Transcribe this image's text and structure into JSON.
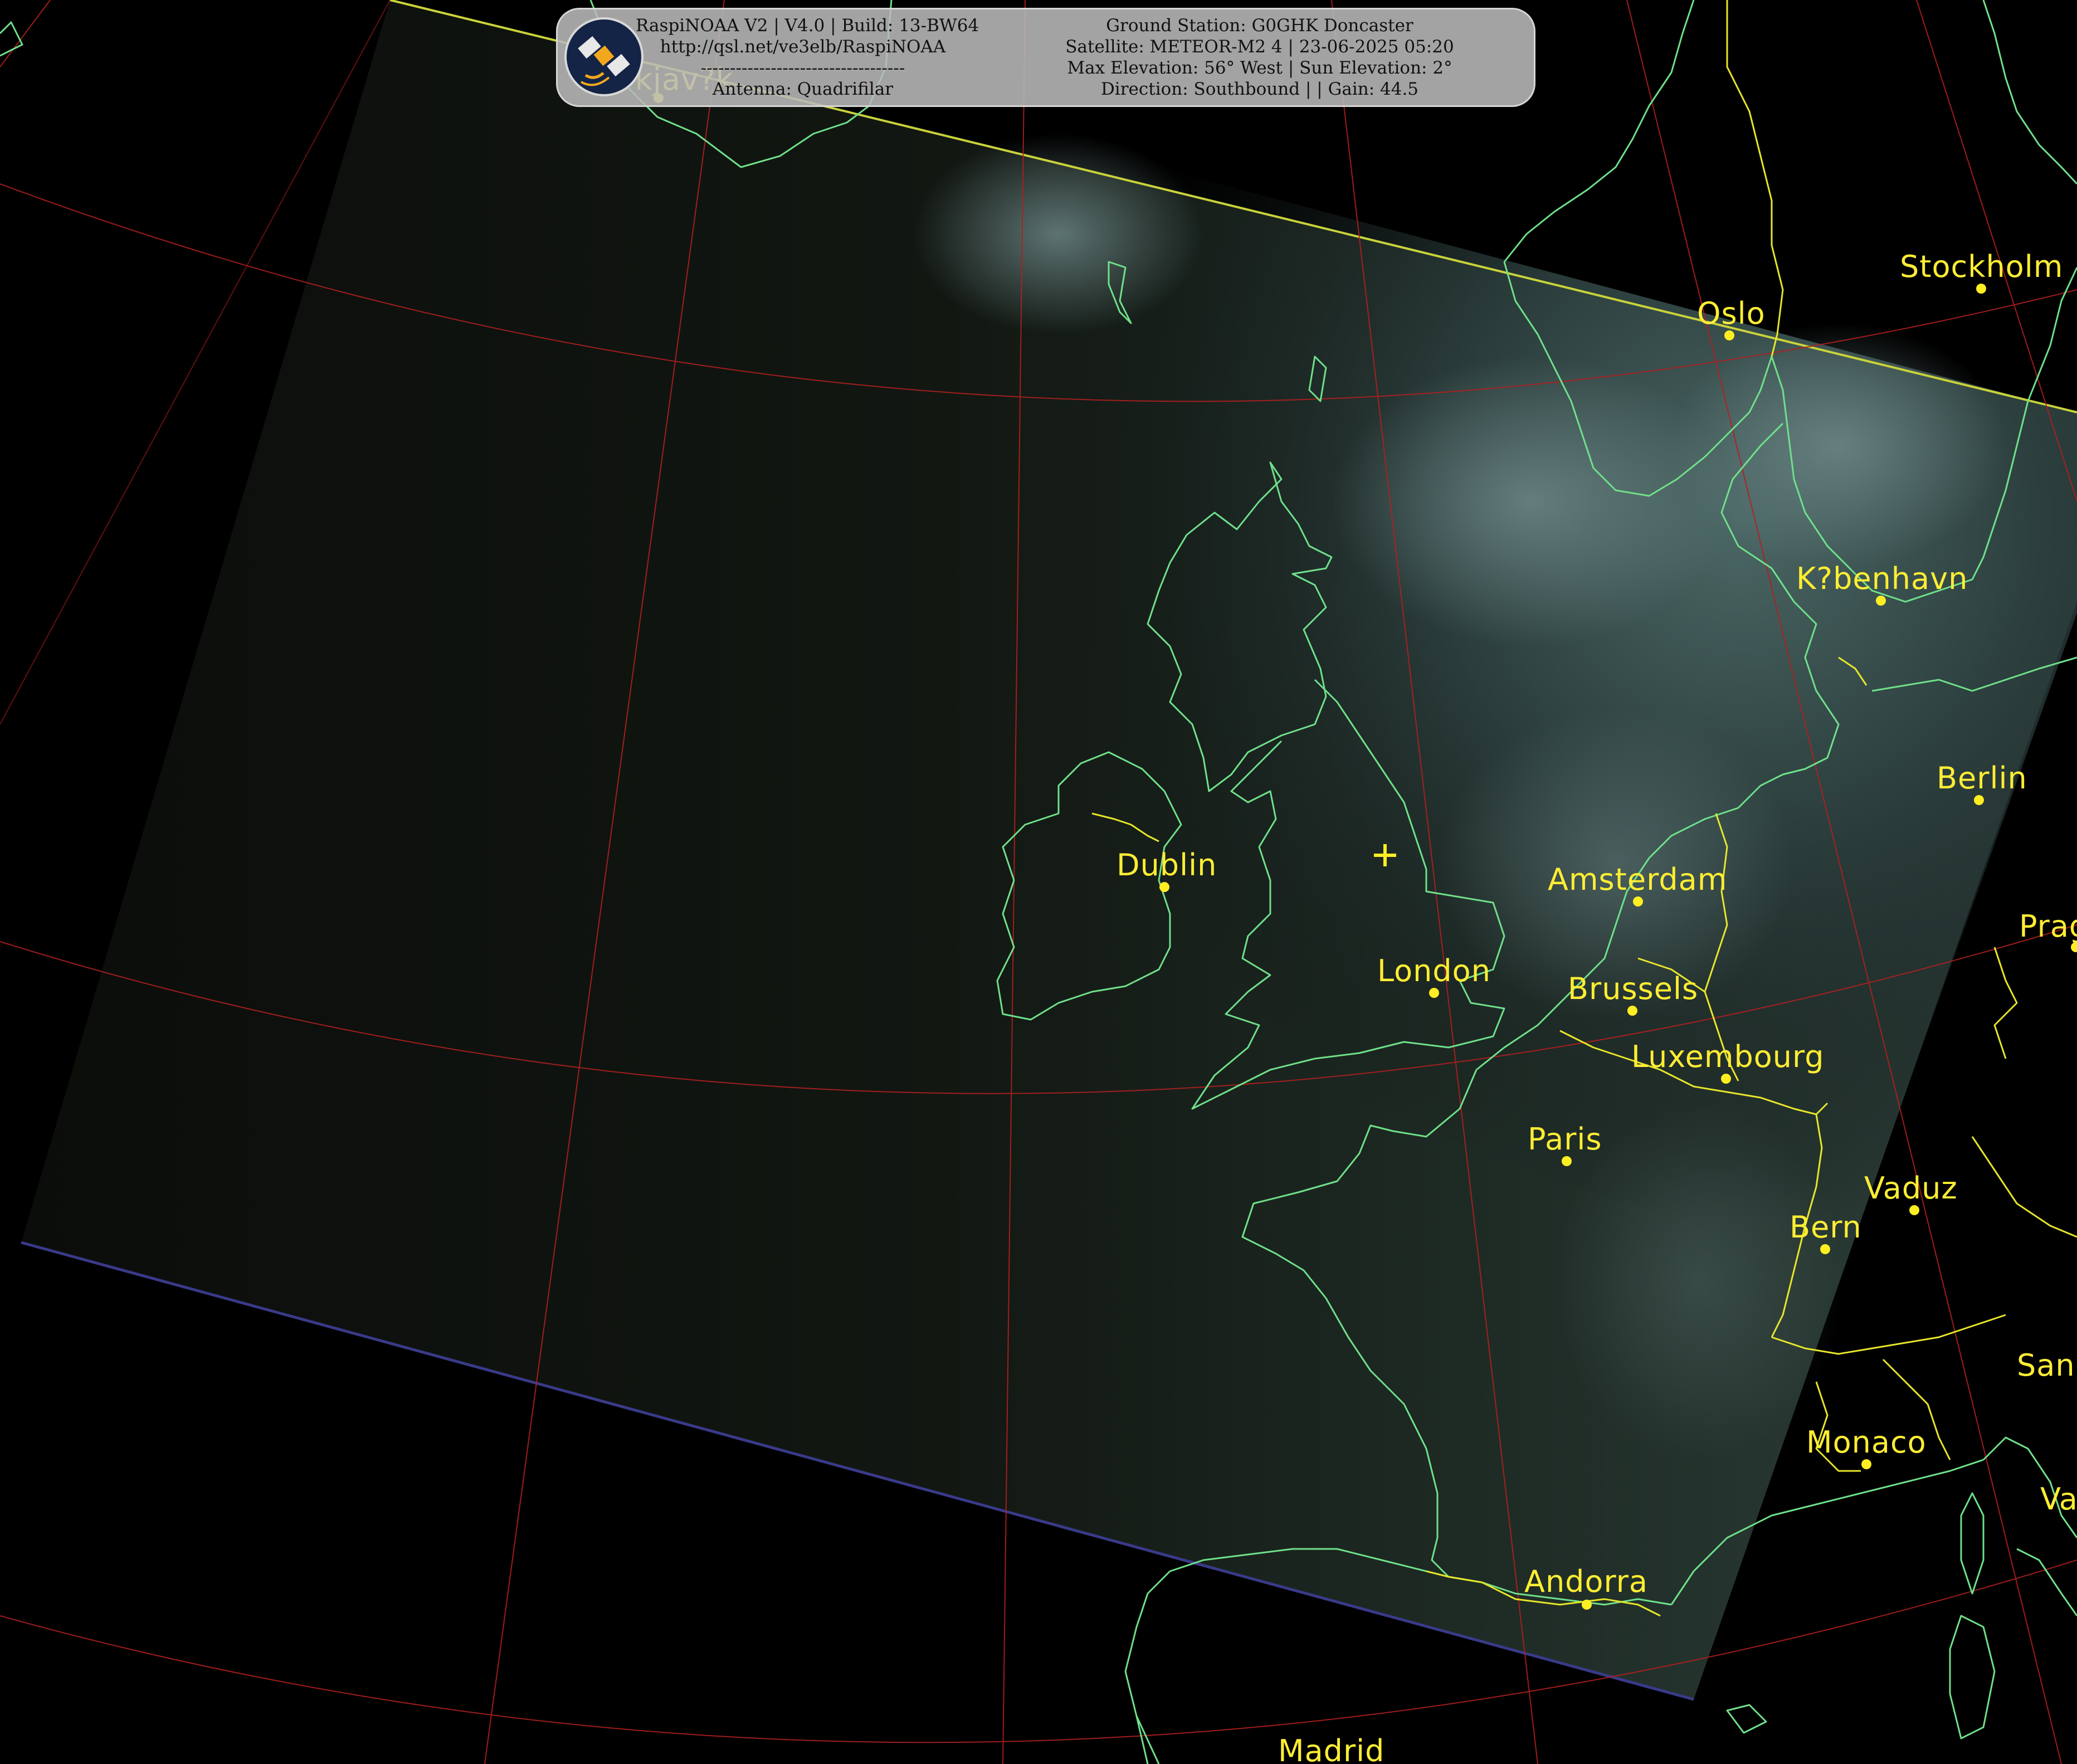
{
  "header": {
    "left_lines": [
      "RaspiNOAA V2 | V4.0 | Build: 13-BW64",
      "http://qsl.net/ve3elb/RaspiNOAA",
      "-----------------------------------",
      "Antenna: Quadrifilar"
    ],
    "right_lines": [
      "Ground Station: G0GHK Doncaster",
      "Satellite: METEOR-M2 4 | 23-06-2025 05:20",
      "Max Elevation: 56° West | Sun Elevation: 2°",
      "Direction: Southbound | | Gain: 44.5"
    ]
  },
  "cities": [
    {
      "id": "reykjavik",
      "label": "?kjav?k"
    },
    {
      "id": "oslo",
      "label": "Oslo"
    },
    {
      "id": "stockholm",
      "label": "Stockholm"
    },
    {
      "id": "kobenhavn",
      "label": "K?benhavn"
    },
    {
      "id": "berlin",
      "label": "Berlin"
    },
    {
      "id": "prague",
      "label": "Prag"
    },
    {
      "id": "dublin",
      "label": "Dublin"
    },
    {
      "id": "amsterdam",
      "label": "Amsterdam"
    },
    {
      "id": "london",
      "label": "London"
    },
    {
      "id": "brussels",
      "label": "Brussels"
    },
    {
      "id": "luxembourg",
      "label": "Luxembourg"
    },
    {
      "id": "paris",
      "label": "Paris"
    },
    {
      "id": "vaduz",
      "label": "Vaduz"
    },
    {
      "id": "bern",
      "label": "Bern"
    },
    {
      "id": "sanmarino",
      "label": "San"
    },
    {
      "id": "monaco",
      "label": "Monaco"
    },
    {
      "id": "vatican",
      "label": "Va"
    },
    {
      "id": "andorra",
      "label": "Andorra"
    },
    {
      "id": "madrid",
      "label": "Madrid"
    }
  ],
  "colors": {
    "coastline": "#6fe08a",
    "border": "#e6e62a",
    "graticule": "#b02020",
    "city": "#ffee33"
  }
}
